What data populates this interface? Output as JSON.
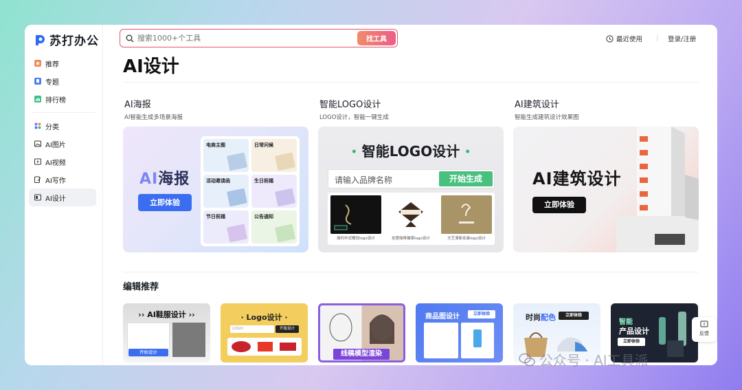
{
  "app": {
    "name": "苏打办公"
  },
  "sidebar": {
    "items": [
      {
        "label": "推荐",
        "icon": "star-icon",
        "color": "#f08a5d"
      },
      {
        "label": "专题",
        "icon": "bookmark-icon",
        "color": "#4a7cf0"
      },
      {
        "label": "排行榜",
        "icon": "chart-icon",
        "color": "#3bbf8a"
      },
      {
        "label": "分类",
        "icon": "grid-icon",
        "color": "#8b6cf0"
      },
      {
        "label": "AI图片",
        "icon": "image-icon",
        "color": "#333333"
      },
      {
        "label": "AI视频",
        "icon": "video-icon",
        "color": "#333333"
      },
      {
        "label": "AI写作",
        "icon": "pen-icon",
        "color": "#333333"
      },
      {
        "label": "AI设计",
        "icon": "design-icon",
        "color": "#333333"
      }
    ],
    "active": "AI设计"
  },
  "header": {
    "search_placeholder": "搜索1000+个工具",
    "search_button": "找工具",
    "recent": "最近使用",
    "login": "登录/注册"
  },
  "page": {
    "title": "AI设计"
  },
  "cards": [
    {
      "title": "AI海报",
      "subtitle": "AI智能生成多场景海报",
      "banner_ai": "AI",
      "banner_rest": "海报",
      "button": "立即体验",
      "tiles": [
        "电商主图",
        "日常问候",
        "活动邀请函",
        "生日祝福",
        "节日祝福",
        "公告通知"
      ]
    },
    {
      "title": "智能LOGO设计",
      "subtitle": "LOGO设计，智能一键生成",
      "banner": "智能LOGO设计",
      "input_placeholder": "请输入品牌名称",
      "button": "开始生成",
      "samples": [
        "简约中式餐饮logo设计",
        "创意咖啡徽章logo设计",
        "文艺清新女装logo设计"
      ]
    },
    {
      "title": "AI建筑设计",
      "subtitle": "智能生成建筑设计效果图",
      "banner": "AI建筑设计",
      "button": "立即体验"
    }
  ],
  "recommend": {
    "title": "编辑推荐",
    "items": [
      {
        "label": "AI鞋服设计",
        "action": "开始设计"
      },
      {
        "label": "Logo设计",
        "action": "开始设计"
      },
      {
        "label": "线稿模型渲染"
      },
      {
        "label": "商品图设计",
        "action": "立即体验"
      },
      {
        "label_a": "时尚",
        "label_b": "配色",
        "action": "立即体验"
      },
      {
        "label_a": "智能",
        "label_b": "产品设计",
        "action": "立即体验"
      }
    ]
  },
  "feedback": "反馈",
  "watermark": "公众号 · AI工具派",
  "colors": {
    "accent": "#e3566e",
    "brand": "#2b6cf6",
    "green": "#4ac07f"
  }
}
